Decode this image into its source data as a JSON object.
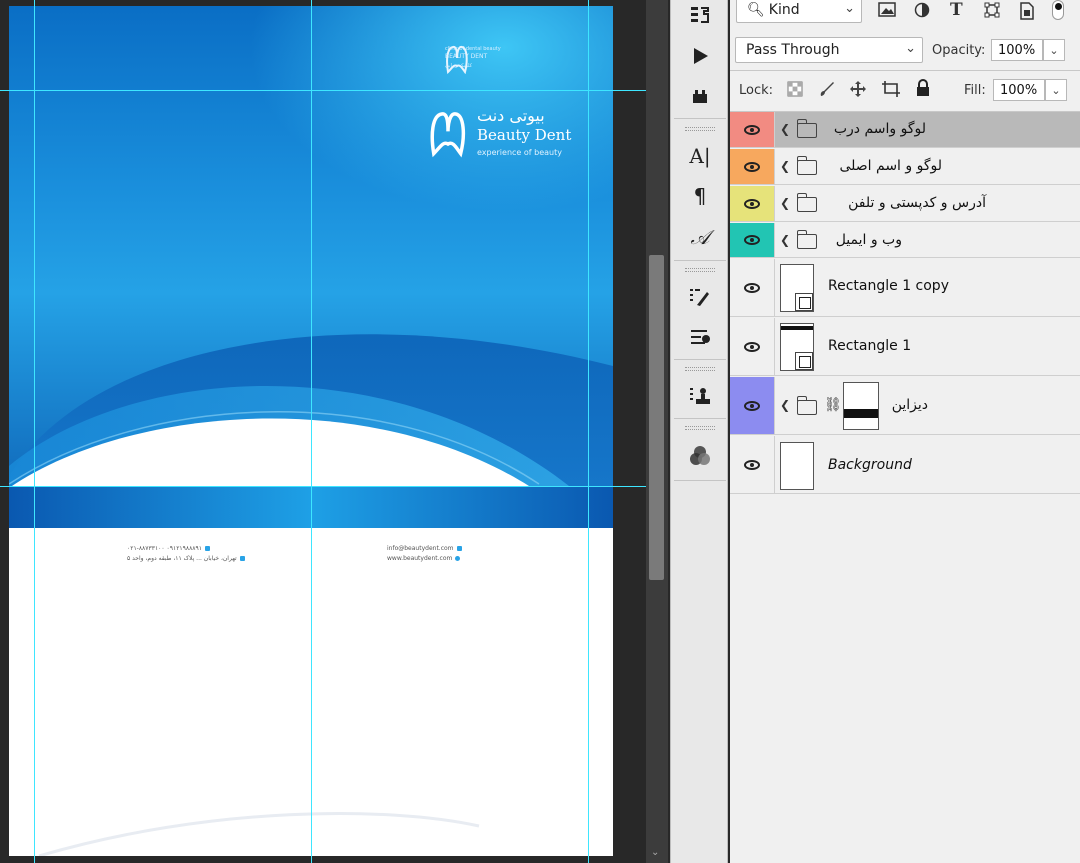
{
  "canvas": {
    "logo_small": {
      "line1": "clinic of dental beauty",
      "line2": "BEAUTY DENT",
      "line3": "کلینیک زیبایی"
    },
    "logo_big": {
      "brand_fa": "بیوتی دنت",
      "brand_en": "Beauty Dent",
      "tagline": "experience of beauty"
    },
    "contact": {
      "email": "info@beautydent.com",
      "web": "www.beautydent.com",
      "phone": "۰۲۱-۸۸۷۳۳۱۰۰   ۰۹۱۲۱۹۸۸۸۹۱",
      "address": "تهران، خیابان ... پلاک ۱۱، طبقه دوم، واحد ۵"
    }
  },
  "tools": {
    "icons": [
      "history-brush-icon",
      "play-icon",
      "stamp-icon",
      "type-icon",
      "paragraph-icon",
      "glyph-icon",
      "brush-settings-icon",
      "adjust-icon",
      "stamp-settings-icon",
      "color-circles-icon"
    ]
  },
  "layers_panel": {
    "filter": {
      "kind_label": "Kind"
    },
    "blend_mode": "Pass Through",
    "opacity_label": "Opacity:",
    "opacity_value": "100%",
    "lock_label": "Lock:",
    "fill_label": "Fill:",
    "fill_value": "100%",
    "layers": [
      {
        "name": "لوگو واسم درب",
        "type": "group",
        "color": "#f28b82",
        "selected": true
      },
      {
        "name": "لوگو و اسم اصلی",
        "type": "group",
        "color": "#f7a85e",
        "selected": false
      },
      {
        "name": "آدرس و کدپستی و تلفن",
        "type": "group",
        "color": "#e6e37a",
        "selected": false
      },
      {
        "name": "وب و ایمیل",
        "type": "group",
        "color": "#22c5b3",
        "selected": false
      },
      {
        "name": "Rectangle 1 copy",
        "type": "shape",
        "color": "",
        "selected": false
      },
      {
        "name": "Rectangle 1",
        "type": "shape",
        "color": "",
        "selected": false
      },
      {
        "name": "دیزاین",
        "type": "group-mask",
        "color": "#8c8cf0",
        "selected": false
      },
      {
        "name": "Background",
        "type": "background",
        "color": "",
        "selected": false
      }
    ]
  }
}
